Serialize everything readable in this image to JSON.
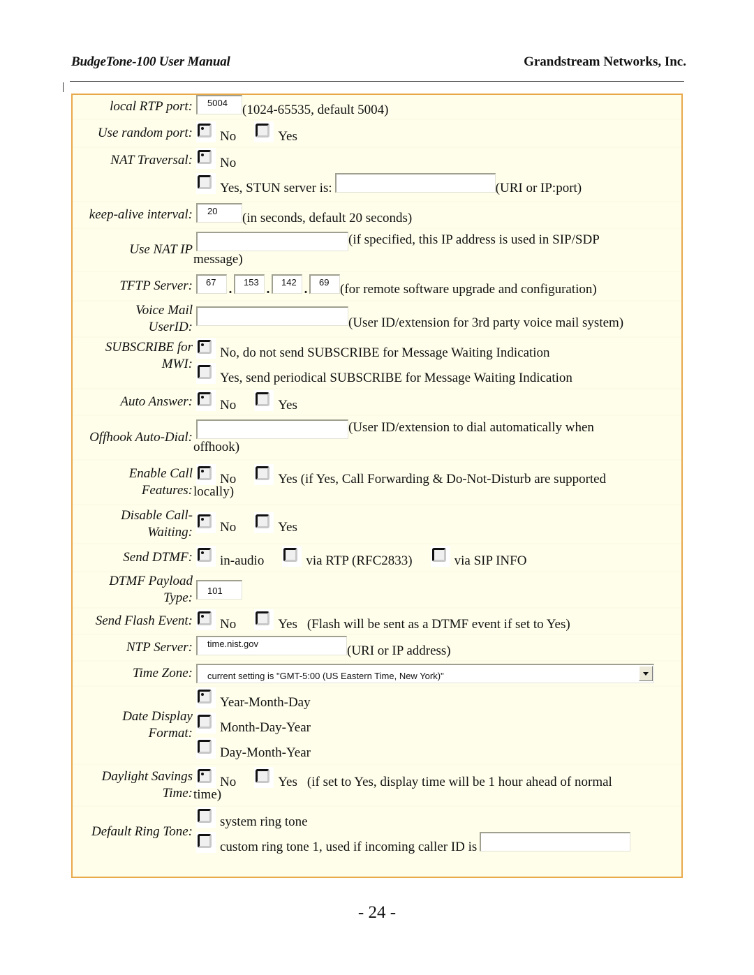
{
  "header": {
    "left": "BudgeTone-100 User Manual",
    "right": "Grandstream Networks, Inc."
  },
  "colors": {
    "panel_bg": "#fffeeb",
    "panel_border": "#e8a94a"
  },
  "fields": {
    "local_rtp_port": {
      "label": "local RTP port:",
      "value": "5004",
      "note": "(1024-65535, default 5004)"
    },
    "use_random_port": {
      "label": "Use random port:",
      "options": [
        "No",
        "Yes"
      ],
      "selected": "No"
    },
    "nat_traversal": {
      "label": "NAT Traversal:",
      "options": [
        "No",
        "Yes, STUN server is:"
      ],
      "selected": "No",
      "stun_value": "",
      "note": "(URI or IP:port)"
    },
    "keep_alive": {
      "label": "keep-alive interval:",
      "value": "20",
      "note": "(in seconds, default 20 seconds)"
    },
    "use_nat_ip": {
      "label": "Use NAT IP",
      "value": "",
      "note": "(if specified, this IP address is used in SIP/SDP",
      "note_cont": "message)"
    },
    "tftp_server": {
      "label": "TFTP Server:",
      "octets": [
        "67",
        "153",
        "142",
        "69"
      ],
      "separator": ".",
      "note": "(for remote software upgrade and configuration)"
    },
    "voice_mail": {
      "label_l1": "Voice Mail",
      "label_l2": "UserID:",
      "value": "",
      "note": "(User ID/extension for 3rd party voice mail system)"
    },
    "subscribe_mwi": {
      "label_l1": "SUBSCRIBE for",
      "label_l2": "MWI:",
      "options": [
        "No, do not send SUBSCRIBE for Message Waiting Indication",
        "Yes, send periodical SUBSCRIBE for Message Waiting Indication"
      ],
      "selected": 0
    },
    "auto_answer": {
      "label": "Auto Answer:",
      "options": [
        "No",
        "Yes"
      ],
      "selected": "No"
    },
    "offhook_autodial": {
      "label": "Offhook Auto-Dial:",
      "value": "",
      "note": "(User ID/extension to dial automatically when",
      "note_cont": "offhook)"
    },
    "enable_call_features": {
      "label_l1": "Enable Call",
      "label_l2": "Features:",
      "options": [
        "No",
        "Yes (if Yes, Call Forwarding & Do-Not-Disturb are supported"
      ],
      "note_cont": "locally)",
      "selected": "No"
    },
    "disable_call_waiting": {
      "label_l1": "Disable Call-",
      "label_l2": "Waiting:",
      "options": [
        "No",
        "Yes"
      ],
      "selected": "No"
    },
    "send_dtmf": {
      "label": "Send DTMF:",
      "options": [
        "in-audio",
        "via RTP (RFC2833)",
        "via SIP INFO"
      ],
      "selected": "in-audio"
    },
    "dtmf_payload": {
      "label_l1": "DTMF Payload",
      "label_l2": "Type:",
      "value": "101"
    },
    "send_flash": {
      "label": "Send Flash Event:",
      "options": [
        "No",
        "Yes"
      ],
      "selected": "No",
      "note": "(Flash will be sent as a DTMF event if set to Yes)"
    },
    "ntp_server": {
      "label": "NTP Server:",
      "value": "time.nist.gov",
      "note": "(URI or IP address)"
    },
    "time_zone": {
      "label": "Time Zone:",
      "selected": "current setting is \"GMT-5:00 (US Eastern Time, New  York)\""
    },
    "date_format": {
      "label_l1": "Date Display",
      "label_l2": "Format:",
      "options": [
        "Year-Month-Day",
        "Month-Day-Year",
        "Day-Month-Year"
      ],
      "selected": "Year-Month-Day"
    },
    "daylight_savings": {
      "label_l1": "Daylight Savings",
      "label_l2": "Time:",
      "options": [
        "No",
        "Yes"
      ],
      "selected": "No",
      "note": "(if set to Yes, display time will be 1 hour ahead of normal",
      "note_cont": "time)"
    },
    "default_ring_tone": {
      "label": "Default Ring Tone:",
      "options": [
        "system ring tone",
        "custom ring tone 1, used if incoming caller ID is"
      ],
      "selected": null,
      "caller_id_value": ""
    }
  },
  "footer": {
    "page_number": "- 24 -"
  }
}
